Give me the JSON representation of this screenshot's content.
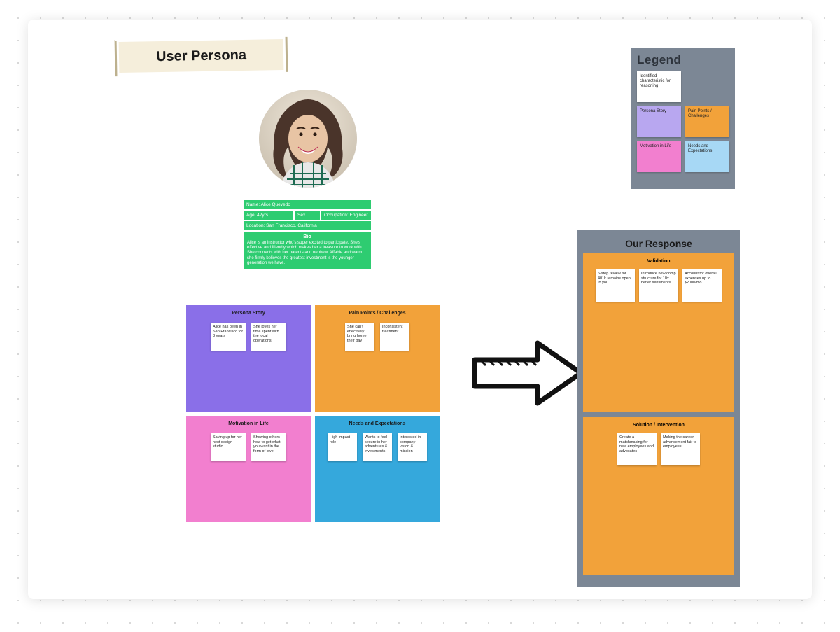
{
  "title": "User Persona",
  "info": {
    "name_label": "Name: Alice Quevedo",
    "age_label": "Age: 42yrs",
    "sex_label": "Sex",
    "occupation_label": "Occupation: Engineer",
    "location_label": "Location: San Francisco, California",
    "bio_title": "Bio",
    "bio_text": "Alice is an instructor who's super excited to participate. She's effective and friendly which makes her a treasure to work with. She connects with her parents and nephew. Affable and warm, she firmly believes the greatest investment is the younger generation we have."
  },
  "panels": {
    "story": {
      "title": "Persona Story",
      "notes": [
        "Alice has been in San Francisco for 8 years",
        "She loves her time spent with the local operations"
      ]
    },
    "pain": {
      "title": "Pain Points / Challenges",
      "notes": [
        "She can't effectively bring home their pay",
        "Inconsistent treatment"
      ]
    },
    "motivation": {
      "title": "Motivation in Life",
      "notes": [
        "Saving up for her next design studio",
        "Showing others how to get what you want in the form of love"
      ]
    },
    "needs": {
      "title": "Needs and Expectations",
      "notes": [
        "High impact role",
        "Wants to feel secure in her adventures & investments",
        "Interested in company vision & mission"
      ]
    }
  },
  "response": {
    "title": "Our Response",
    "validation": {
      "title": "Validation",
      "notes": [
        "6-step review for 401k remains open to you",
        "Introduce new comp structure for 10x better sentiments",
        "Account for overall expenses up to $2000/mo"
      ]
    },
    "solution": {
      "title": "Solution / Intervention",
      "notes": [
        "Create a matchmaking for new employees and advocates",
        "Making the career advancement fair to employees"
      ]
    }
  },
  "legend": {
    "title": "Legend",
    "items": {
      "white": "Identified characteristic for reasoning",
      "purple": "Persona Story",
      "orange": "Pain Points / Challenges",
      "pink": "Motivation in Life",
      "blue": "Needs and Expectations"
    }
  }
}
